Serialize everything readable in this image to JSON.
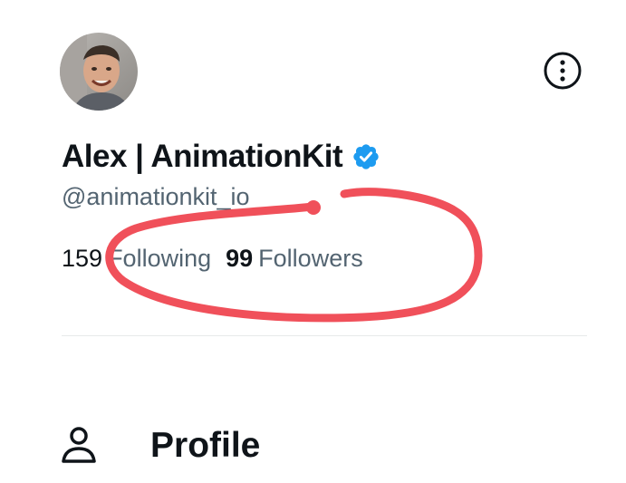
{
  "profile": {
    "display_name": "Alex | AnimationKit",
    "handle": "@animationkit_io",
    "verified": true
  },
  "stats": {
    "following_count": "159",
    "following_label": "Following",
    "followers_count": "99",
    "followers_label": "Followers"
  },
  "icons": {
    "avatar": "avatar",
    "more": "more-options-icon",
    "verified": "verified-badge-icon",
    "profile": "person-icon"
  },
  "nav": {
    "profile_label": "Profile"
  },
  "colors": {
    "text_primary": "#0f1419",
    "text_secondary": "#536471",
    "verified_blue": "#1d9bf0",
    "annotation_red": "#f0505a",
    "divider": "#e7e9ea"
  }
}
